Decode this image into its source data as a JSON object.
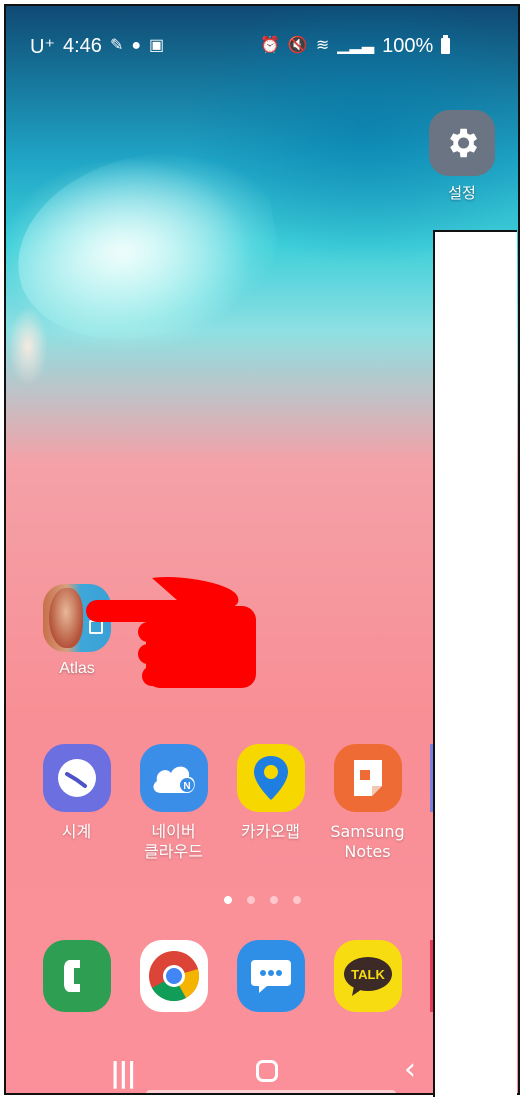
{
  "status_bar": {
    "carrier": "U⁺",
    "time": "4:46",
    "battery": "100%"
  },
  "settings_app": {
    "label": "설정"
  },
  "atlas_app": {
    "label": "Atlas"
  },
  "app_row": [
    {
      "label": "시계"
    },
    {
      "label": "네이버\n클라우드"
    },
    {
      "label": "카카오맵"
    },
    {
      "label": "Samsung\nNotes"
    }
  ],
  "dock": {
    "kakaotalk_text": "TALK"
  },
  "page_indicator": {
    "count": 4,
    "active_index": 0
  },
  "colors": {
    "clock": "#6b6fe0",
    "naver_cloud": "#3b8ee8",
    "kakaomap": "#f7d700",
    "samsung_notes": "#ef6b35",
    "phone": "#2e9e52",
    "messages": "#2f8fe6",
    "kakaotalk": "#f7dc12",
    "hand": "#ff0000"
  }
}
